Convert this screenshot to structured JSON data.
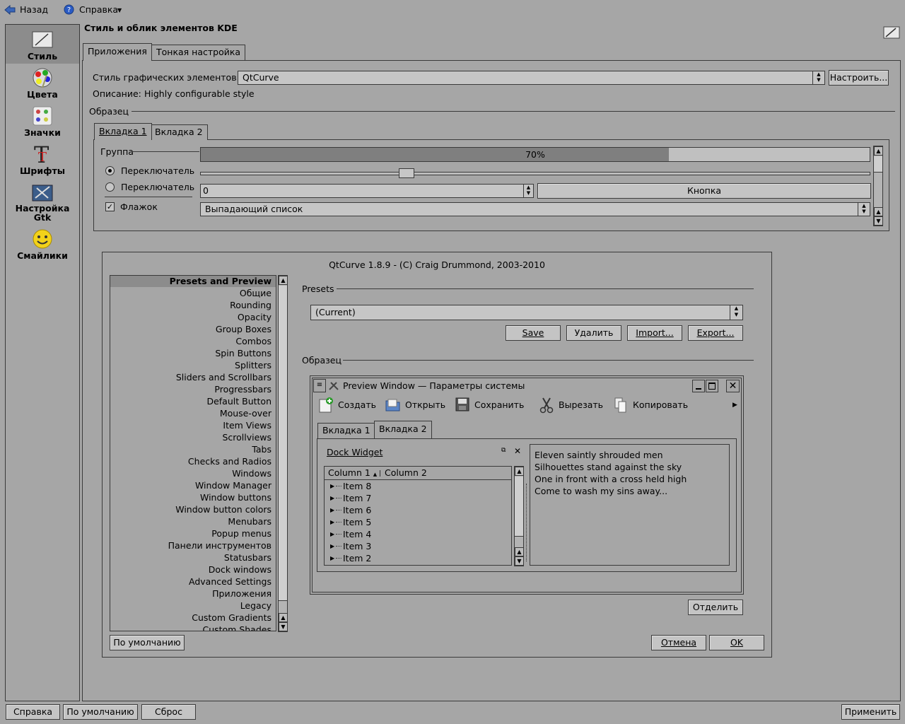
{
  "toolbar": {
    "back": "Назад",
    "help": "Справка"
  },
  "sidebar": {
    "items": [
      {
        "label": "Стиль"
      },
      {
        "label": "Цвета"
      },
      {
        "label": "Значки"
      },
      {
        "label": "Шрифты"
      },
      {
        "label": "Настройка\nGtk"
      },
      {
        "label": "Смайлики"
      }
    ]
  },
  "header": {
    "title": "Стиль и облик элементов KDE"
  },
  "tabs": {
    "apps": "Приложения",
    "fine": "Тонкая настройка"
  },
  "style": {
    "label": "Стиль графических элементов:",
    "value": "QtCurve",
    "configure": "Настроить...",
    "desc_label": "Описание:",
    "desc_value": "Highly configurable style",
    "sample": "Образец"
  },
  "preview": {
    "tab1": "Вкладка 1",
    "tab2": "Вкладка 2",
    "group": "Группа",
    "radio1": "Переключатель",
    "radio2": "Переключатель",
    "checkbox": "Флажок",
    "progress": 0.7,
    "progress_text": "70%",
    "spin_value": "0",
    "button": "Кнопка",
    "combo": "Выпадающий список"
  },
  "dialog": {
    "title": "QtCurve 1.8.9 - (C) Craig Drummond, 2003-2010",
    "nav": [
      "Presets and Preview",
      "Общие",
      "Rounding",
      "Opacity",
      "Group Boxes",
      "Combos",
      "Spin Buttons",
      "Splitters",
      "Sliders and Scrollbars",
      "Progressbars",
      "Default Button",
      "Mouse-over",
      "Item Views",
      "Scrollviews",
      "Tabs",
      "Checks and Radios",
      "Windows",
      "Window Manager",
      "Window buttons",
      "Window button colors",
      "Menubars",
      "Popup menus",
      "Панели инструментов",
      "Statusbars",
      "Dock windows",
      "Advanced Settings",
      "Приложения",
      "Legacy",
      "Custom Gradients",
      "Custom Shades"
    ],
    "presets_label": "Presets",
    "preset_value": "(Current)",
    "save": "Save",
    "delete": "Удалить",
    "import": "Import...",
    "export": "Export...",
    "sample": "Образец",
    "detach": "Отделить",
    "defaults": "По умолчанию",
    "cancel": "Отмена",
    "ok": "OK"
  },
  "pw": {
    "title": "Preview Window — Параметры системы",
    "create": "Создать",
    "open": "Открыть",
    "save": "Сохранить",
    "cut": "Вырезать",
    "copy": "Копировать",
    "tab1": "Вкладка 1",
    "tab2": "Вкладка 2",
    "dock": "Dock Widget",
    "col1": "Column 1",
    "col2": "Column 2",
    "items": [
      "Item 8",
      "Item 7",
      "Item 6",
      "Item 5",
      "Item 4",
      "Item 3",
      "Item 2"
    ],
    "poem": [
      "Eleven saintly shrouded men",
      "Silhouettes stand against the sky",
      "One in front with a cross held high",
      "Come to wash my sins away..."
    ]
  },
  "bottom": {
    "help": "Справка",
    "defaults": "По умолчанию",
    "reset": "Сброс",
    "apply": "Применить"
  },
  "colors": {
    "bg": "#a6a6a6",
    "progress": "#7f7f7f",
    "sidebar_selected": "#8c8c8c"
  }
}
